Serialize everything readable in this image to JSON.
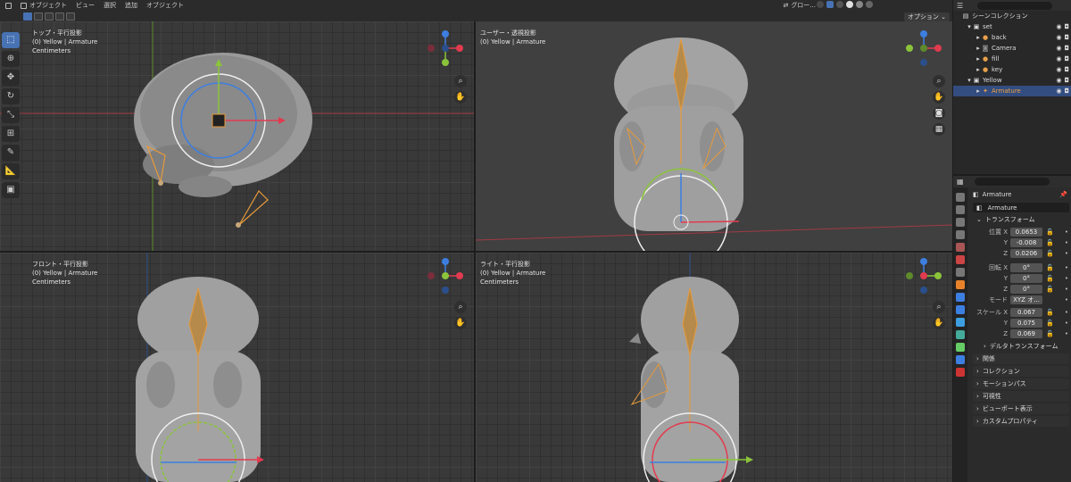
{
  "header": {
    "menu": [
      "オブジェクト",
      "ビュー",
      "選択",
      "追加",
      "オブジェクト"
    ],
    "transform_orientation": "グロー...",
    "options_label": "オプション"
  },
  "viewports": [
    {
      "view": "トップ・平行投影",
      "object": "(0) Yellow | Armature",
      "units": "Centimeters"
    },
    {
      "view": "ユーザー・透視投影",
      "object": "(0) Yellow | Armature",
      "units": ""
    },
    {
      "view": "フロント・平行投影",
      "object": "(0) Yellow | Armature",
      "units": "Centimeters"
    },
    {
      "view": "ライト・平行投影",
      "object": "(0) Yellow | Armature",
      "units": "Centimeters"
    }
  ],
  "outliner": {
    "title": "シーンコレクション",
    "items": [
      {
        "label": "set",
        "depth": 1,
        "icon": "collection-icon"
      },
      {
        "label": "back",
        "depth": 2,
        "icon": "light-icon"
      },
      {
        "label": "Camera",
        "depth": 2,
        "icon": "camera-icon"
      },
      {
        "label": "fill",
        "depth": 2,
        "icon": "light-icon"
      },
      {
        "label": "key",
        "depth": 2,
        "icon": "light-icon"
      },
      {
        "label": "Yellow",
        "depth": 1,
        "icon": "collection-icon"
      },
      {
        "label": "Armature",
        "depth": 2,
        "icon": "armature-icon",
        "selected": true
      }
    ]
  },
  "properties": {
    "object_name": "Armature",
    "data_name": "Armature",
    "transform_label": "トランスフォーム",
    "location_label": "位置",
    "rotation_label": "回転",
    "scale_label": "スケール",
    "mode_label": "モード",
    "location": {
      "x": "0.0653",
      "y": "-0.008",
      "z": "0.0206"
    },
    "rotation": {
      "x": "0°",
      "y": "0°",
      "z": "0°"
    },
    "rotation_mode": "XYZ オ...",
    "scale": {
      "x": "0.067",
      "y": "0.075",
      "z": "0.069"
    },
    "axis_labels": {
      "x": "X",
      "y": "Y",
      "z": "Z"
    },
    "sections": [
      "デルタトランスフォーム",
      "関係",
      "コレクション",
      "モーションパス",
      "可視性",
      "ビューポート表示",
      "カスタムプロパティ"
    ]
  },
  "colors": {
    "accent": "#4772b3",
    "x_axis": "#e23b4f",
    "y_axis": "#8bc43a",
    "z_axis": "#3d7fe0",
    "bone": "#e89a3a"
  }
}
